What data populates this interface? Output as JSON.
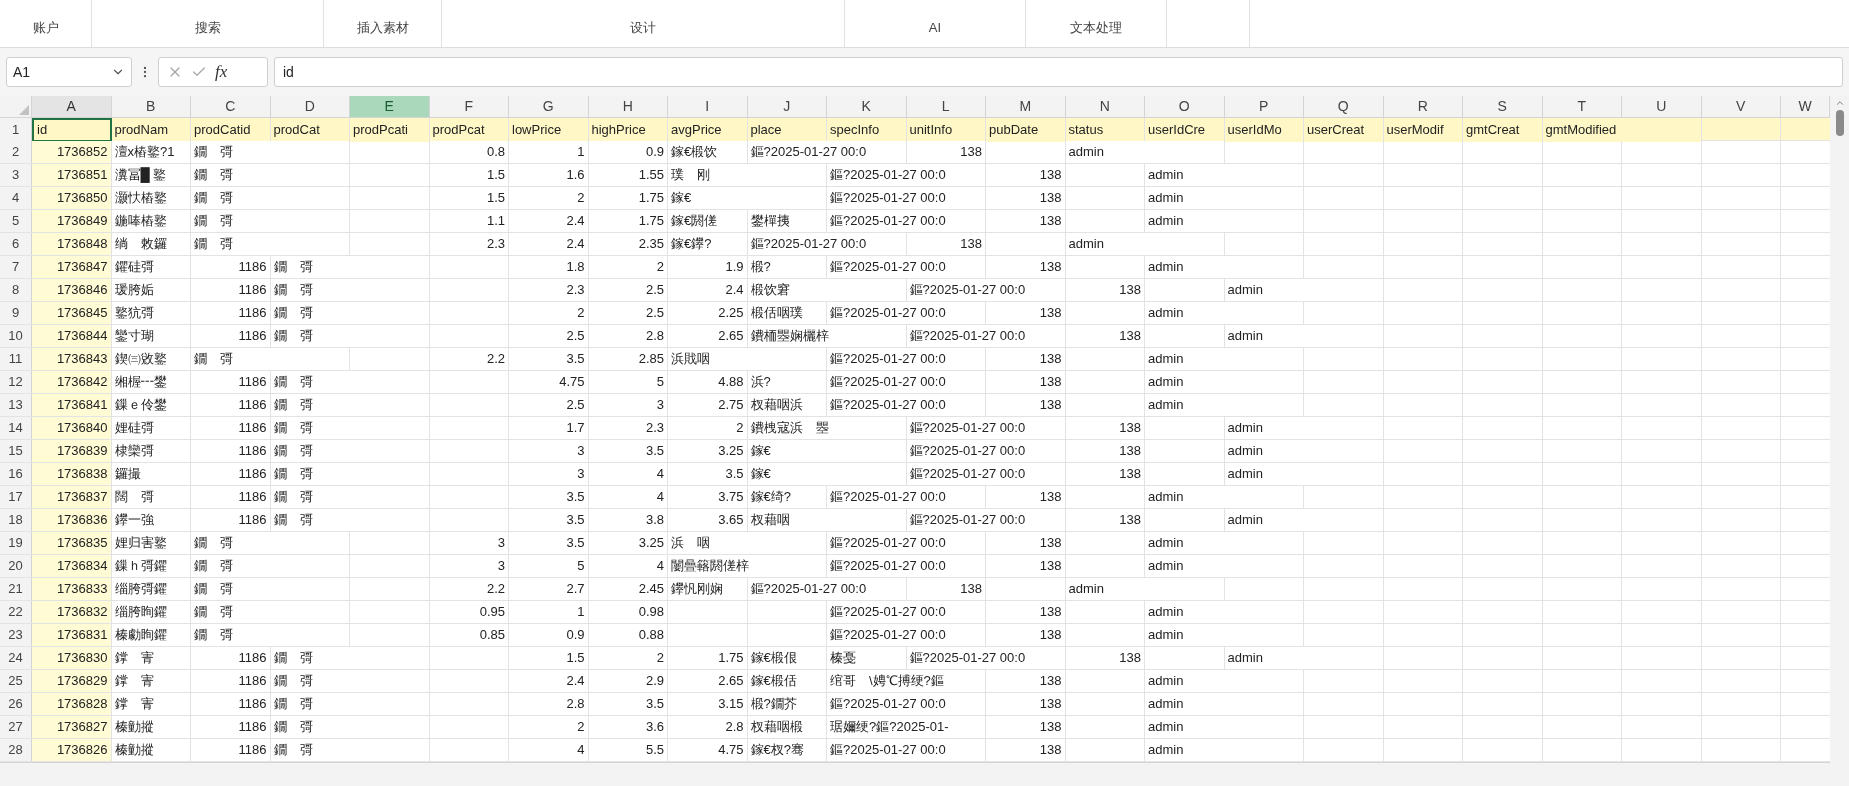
{
  "ribbon": {
    "groups": [
      {
        "label": "账户"
      },
      {
        "label": "搜索"
      },
      {
        "label": "插入素材"
      },
      {
        "label": "设计"
      },
      {
        "label": "AI"
      },
      {
        "label": "文本处理"
      }
    ]
  },
  "formula_bar": {
    "name_box": "A1",
    "fx": "fx",
    "value": "id"
  },
  "columns": [
    {
      "label": "A",
      "selected": false,
      "highlighted": true
    },
    {
      "label": "B",
      "selected": false,
      "highlighted": false
    },
    {
      "label": "C",
      "selected": false,
      "highlighted": false
    },
    {
      "label": "D",
      "selected": false,
      "highlighted": false
    },
    {
      "label": "E",
      "selected": true,
      "highlighted": false
    },
    {
      "label": "F",
      "selected": false,
      "highlighted": false
    },
    {
      "label": "G",
      "selected": false,
      "highlighted": false
    },
    {
      "label": "H",
      "selected": false,
      "highlighted": false
    },
    {
      "label": "I",
      "selected": false,
      "highlighted": false
    },
    {
      "label": "J",
      "selected": false,
      "highlighted": false
    },
    {
      "label": "K",
      "selected": false,
      "highlighted": false
    },
    {
      "label": "L",
      "selected": false,
      "highlighted": false
    },
    {
      "label": "M",
      "selected": false,
      "highlighted": false
    },
    {
      "label": "N",
      "selected": false,
      "highlighted": false
    },
    {
      "label": "O",
      "selected": false,
      "highlighted": false
    },
    {
      "label": "P",
      "selected": false,
      "highlighted": false
    },
    {
      "label": "Q",
      "selected": false,
      "highlighted": false
    },
    {
      "label": "R",
      "selected": false,
      "highlighted": false
    },
    {
      "label": "S",
      "selected": false,
      "highlighted": false
    },
    {
      "label": "T",
      "selected": false,
      "highlighted": false
    },
    {
      "label": "U",
      "selected": false,
      "highlighted": false
    },
    {
      "label": "V",
      "selected": false,
      "highlighted": false
    },
    {
      "label": "W",
      "selected": false,
      "highlighted": false
    }
  ],
  "header_row": {
    "num": "1",
    "cells": [
      {
        "text": "id",
        "selected": true
      },
      {
        "text": "prodNam",
        "selected": false
      },
      {
        "text": "prodCatid",
        "selected": false
      },
      {
        "text": "prodCat",
        "selected": false
      },
      {
        "text": "prodPcati",
        "selected": false
      },
      {
        "text": "prodPcat",
        "selected": false
      },
      {
        "text": "lowPrice",
        "selected": false
      },
      {
        "text": "highPrice",
        "selected": false
      },
      {
        "text": "avgPrice",
        "selected": false
      },
      {
        "text": "place",
        "selected": false
      },
      {
        "text": "specInfo",
        "selected": false
      },
      {
        "text": "unitInfo",
        "selected": false
      },
      {
        "text": "pubDate",
        "selected": false
      },
      {
        "text": "status",
        "selected": false
      },
      {
        "text": "userIdCre",
        "selected": false
      },
      {
        "text": "userIdMo",
        "selected": false
      },
      {
        "text": "userCreat",
        "selected": false
      },
      {
        "text": "userModif",
        "selected": false
      },
      {
        "text": "gmtCreat",
        "selected": false
      },
      {
        "text": "gmtModified",
        "selected": false
      }
    ]
  },
  "rows": [
    {
      "num": "2",
      "cells": [
        {
          "kind": "num",
          "text": "1736852"
        },
        {
          "kind": "text",
          "text": "澶x樁鐜?1"
        },
        {
          "kind": "text",
          "text": "鐗　彁"
        },
        {
          "kind": "empty"
        },
        {
          "kind": "empty"
        },
        {
          "kind": "num",
          "text": "0.8"
        },
        {
          "kind": "num",
          "text": "1"
        },
        {
          "kind": "num",
          "text": "0.9"
        },
        {
          "kind": "text",
          "text": "鎵€椴饮"
        },
        {
          "kind": "text",
          "text": "鏂?2025-01-27 00:0"
        },
        {
          "kind": "empty"
        },
        {
          "kind": "num",
          "text": "138"
        },
        {
          "kind": "empty"
        },
        {
          "kind": "text",
          "text": "admin"
        }
      ]
    },
    {
      "num": "3",
      "cells": [
        {
          "kind": "num",
          "text": "1736851"
        },
        {
          "kind": "text",
          "text": "瀵冨█ 鐜"
        },
        {
          "kind": "text",
          "text": "鐗　彁"
        },
        {
          "kind": "empty"
        },
        {
          "kind": "empty"
        },
        {
          "kind": "num",
          "text": "1.5"
        },
        {
          "kind": "num",
          "text": "1.6"
        },
        {
          "kind": "num",
          "text": "1.55"
        },
        {
          "kind": "text",
          "text": "璞　刚"
        },
        {
          "kind": "empty"
        },
        {
          "kind": "text",
          "text": "鏂?2025-01-27 00:0"
        },
        {
          "kind": "empty"
        },
        {
          "kind": "num",
          "text": "138"
        },
        {
          "kind": "empty"
        },
        {
          "kind": "text",
          "text": "admin"
        }
      ]
    },
    {
      "num": "4",
      "cells": [
        {
          "kind": "num",
          "text": "1736850"
        },
        {
          "kind": "text",
          "text": "灏忕樁鐜"
        },
        {
          "kind": "text",
          "text": "鐗　彁"
        },
        {
          "kind": "empty"
        },
        {
          "kind": "empty"
        },
        {
          "kind": "num",
          "text": "1.5"
        },
        {
          "kind": "num",
          "text": "2"
        },
        {
          "kind": "num",
          "text": "1.75"
        },
        {
          "kind": "text",
          "text": "鎵€"
        },
        {
          "kind": "empty"
        },
        {
          "kind": "text",
          "text": "鏂?2025-01-27 00:0"
        },
        {
          "kind": "empty"
        },
        {
          "kind": "num",
          "text": "138"
        },
        {
          "kind": "empty"
        },
        {
          "kind": "text",
          "text": "admin"
        }
      ]
    },
    {
      "num": "5",
      "cells": [
        {
          "kind": "num",
          "text": "1736849"
        },
        {
          "kind": "text",
          "text": "鍦唪樁鐜"
        },
        {
          "kind": "text",
          "text": "鐗　彁"
        },
        {
          "kind": "empty"
        },
        {
          "kind": "empty"
        },
        {
          "kind": "num",
          "text": "1.1"
        },
        {
          "kind": "num",
          "text": "2.4"
        },
        {
          "kind": "num",
          "text": "1.75"
        },
        {
          "kind": "text",
          "text": "鎵€閼傞"
        },
        {
          "kind": "text",
          "text": "鐢樿挗"
        },
        {
          "kind": "text",
          "text": "鏂?2025-01-27 00:0"
        },
        {
          "kind": "empty"
        },
        {
          "kind": "num",
          "text": "138"
        },
        {
          "kind": "empty"
        },
        {
          "kind": "text",
          "text": "admin"
        }
      ]
    },
    {
      "num": "6",
      "cells": [
        {
          "kind": "num",
          "text": "1736848"
        },
        {
          "kind": "text",
          "text": "绱　敇鑼"
        },
        {
          "kind": "text",
          "text": "鐗　彁"
        },
        {
          "kind": "empty"
        },
        {
          "kind": "empty"
        },
        {
          "kind": "num",
          "text": "2.3"
        },
        {
          "kind": "num",
          "text": "2.4"
        },
        {
          "kind": "num",
          "text": "2.35"
        },
        {
          "kind": "text",
          "text": "鎵€鑻?"
        },
        {
          "kind": "text",
          "text": "鏂?2025-01-27 00:0"
        },
        {
          "kind": "empty"
        },
        {
          "kind": "num",
          "text": "138"
        },
        {
          "kind": "empty"
        },
        {
          "kind": "text",
          "text": "admin"
        }
      ]
    },
    {
      "num": "7",
      "cells": [
        {
          "kind": "num",
          "text": "1736847"
        },
        {
          "kind": "text",
          "text": "鑺硅彁"
        },
        {
          "kind": "num",
          "text": "1186"
        },
        {
          "kind": "text",
          "text": "鐗　彁"
        },
        {
          "kind": "empty"
        },
        {
          "kind": "empty"
        },
        {
          "kind": "num",
          "text": "1.8"
        },
        {
          "kind": "num",
          "text": "2"
        },
        {
          "kind": "num",
          "text": "1.9"
        },
        {
          "kind": "text",
          "text": "椴?"
        },
        {
          "kind": "text",
          "text": "鏂?2025-01-27 00:0"
        },
        {
          "kind": "empty"
        },
        {
          "kind": "num",
          "text": "138"
        },
        {
          "kind": "empty"
        },
        {
          "kind": "text",
          "text": "admin"
        }
      ]
    },
    {
      "num": "8",
      "cells": [
        {
          "kind": "num",
          "text": "1736846"
        },
        {
          "kind": "text",
          "text": "瑗胯姤"
        },
        {
          "kind": "num",
          "text": "1186"
        },
        {
          "kind": "text",
          "text": "鐗　彁"
        },
        {
          "kind": "empty"
        },
        {
          "kind": "empty"
        },
        {
          "kind": "num",
          "text": "2.3"
        },
        {
          "kind": "num",
          "text": "2.5"
        },
        {
          "kind": "num",
          "text": "2.4"
        },
        {
          "kind": "text",
          "text": "椴饮窘"
        },
        {
          "kind": "empty"
        },
        {
          "kind": "text",
          "text": "鏂?2025-01-27 00:0"
        },
        {
          "kind": "empty"
        },
        {
          "kind": "num",
          "text": "138"
        },
        {
          "kind": "empty"
        },
        {
          "kind": "text",
          "text": "admin"
        }
      ]
    },
    {
      "num": "9",
      "cells": [
        {
          "kind": "num",
          "text": "1736845"
        },
        {
          "kind": "text",
          "text": "鐜犺彁"
        },
        {
          "kind": "num",
          "text": "1186"
        },
        {
          "kind": "text",
          "text": "鐗　彁"
        },
        {
          "kind": "empty"
        },
        {
          "kind": "empty"
        },
        {
          "kind": "num",
          "text": "2"
        },
        {
          "kind": "num",
          "text": "2.5"
        },
        {
          "kind": "num",
          "text": "2.25"
        },
        {
          "kind": "text",
          "text": "椴佸咽璞"
        },
        {
          "kind": "text",
          "text": "鏂?2025-01-27 00:0"
        },
        {
          "kind": "empty"
        },
        {
          "kind": "num",
          "text": "138"
        },
        {
          "kind": "empty"
        },
        {
          "kind": "text",
          "text": "admin"
        }
      ]
    },
    {
      "num": "10",
      "cells": [
        {
          "kind": "num",
          "text": "1736844"
        },
        {
          "kind": "text",
          "text": "鑾寸瑚"
        },
        {
          "kind": "num",
          "text": "1186"
        },
        {
          "kind": "text",
          "text": "鐗　彁"
        },
        {
          "kind": "empty"
        },
        {
          "kind": "empty"
        },
        {
          "kind": "num",
          "text": "2.5"
        },
        {
          "kind": "num",
          "text": "2.8"
        },
        {
          "kind": "num",
          "text": "2.65"
        },
        {
          "kind": "text",
          "text": "鐨栭瞾娴欐梓"
        },
        {
          "kind": "empty"
        },
        {
          "kind": "text",
          "text": "鏂?2025-01-27 00:0"
        },
        {
          "kind": "empty"
        },
        {
          "kind": "num",
          "text": "138"
        },
        {
          "kind": "empty"
        },
        {
          "kind": "text",
          "text": "admin"
        }
      ]
    },
    {
      "num": "11",
      "cells": [
        {
          "kind": "num",
          "text": "1736843"
        },
        {
          "kind": "text",
          "text": "鍥㈢敓鐜"
        },
        {
          "kind": "text",
          "text": "鐗　彁"
        },
        {
          "kind": "empty"
        },
        {
          "kind": "empty"
        },
        {
          "kind": "num",
          "text": "2.2"
        },
        {
          "kind": "num",
          "text": "3.5"
        },
        {
          "kind": "num",
          "text": "2.85"
        },
        {
          "kind": "text",
          "text": "浜戝咽"
        },
        {
          "kind": "empty"
        },
        {
          "kind": "text",
          "text": "鏂?2025-01-27 00:0"
        },
        {
          "kind": "empty"
        },
        {
          "kind": "num",
          "text": "138"
        },
        {
          "kind": "empty"
        },
        {
          "kind": "text",
          "text": "admin"
        }
      ]
    },
    {
      "num": "12",
      "cells": [
        {
          "kind": "num",
          "text": "1736842"
        },
        {
          "kind": "text",
          "text": "缃楃┅鐢"
        },
        {
          "kind": "num",
          "text": "1186"
        },
        {
          "kind": "text",
          "text": "鐗　彁"
        },
        {
          "kind": "empty"
        },
        {
          "kind": "empty"
        },
        {
          "kind": "num",
          "text": "4.75"
        },
        {
          "kind": "num",
          "text": "5"
        },
        {
          "kind": "num",
          "text": "4.88"
        },
        {
          "kind": "text",
          "text": "浜?"
        },
        {
          "kind": "text",
          "text": "鏂?2025-01-27 00:0"
        },
        {
          "kind": "empty"
        },
        {
          "kind": "num",
          "text": "138"
        },
        {
          "kind": "empty"
        },
        {
          "kind": "text",
          "text": "admin"
        }
      ]
    },
    {
      "num": "13",
      "cells": [
        {
          "kind": "num",
          "text": "1736841"
        },
        {
          "kind": "text",
          "text": "鏁ｅ伶鐢"
        },
        {
          "kind": "num",
          "text": "1186"
        },
        {
          "kind": "text",
          "text": "鐗　彁"
        },
        {
          "kind": "empty"
        },
        {
          "kind": "empty"
        },
        {
          "kind": "num",
          "text": "2.5"
        },
        {
          "kind": "num",
          "text": "3"
        },
        {
          "kind": "num",
          "text": "2.75"
        },
        {
          "kind": "text",
          "text": "杈藉咽浜"
        },
        {
          "kind": "text",
          "text": "鏂?2025-01-27 00:0"
        },
        {
          "kind": "empty"
        },
        {
          "kind": "num",
          "text": "138"
        },
        {
          "kind": "empty"
        },
        {
          "kind": "text",
          "text": "admin"
        }
      ]
    },
    {
      "num": "14",
      "cells": [
        {
          "kind": "num",
          "text": "1736840"
        },
        {
          "kind": "text",
          "text": "娌硅彁"
        },
        {
          "kind": "num",
          "text": "1186"
        },
        {
          "kind": "text",
          "text": "鐗　彁"
        },
        {
          "kind": "empty"
        },
        {
          "kind": "empty"
        },
        {
          "kind": "num",
          "text": "1.7"
        },
        {
          "kind": "num",
          "text": "2.3"
        },
        {
          "kind": "num",
          "text": "2"
        },
        {
          "kind": "text",
          "text": "鐨栧寇浜　瞾"
        },
        {
          "kind": "empty"
        },
        {
          "kind": "text",
          "text": "鏂?2025-01-27 00:0"
        },
        {
          "kind": "empty"
        },
        {
          "kind": "num",
          "text": "138"
        },
        {
          "kind": "empty"
        },
        {
          "kind": "text",
          "text": "admin"
        }
      ]
    },
    {
      "num": "15",
      "cells": [
        {
          "kind": "num",
          "text": "1736839"
        },
        {
          "kind": "text",
          "text": "棣欒彁"
        },
        {
          "kind": "num",
          "text": "1186"
        },
        {
          "kind": "text",
          "text": "鐗　彁"
        },
        {
          "kind": "empty"
        },
        {
          "kind": "empty"
        },
        {
          "kind": "num",
          "text": "3"
        },
        {
          "kind": "num",
          "text": "3.5"
        },
        {
          "kind": "num",
          "text": "3.25"
        },
        {
          "kind": "text",
          "text": "鎵€"
        },
        {
          "kind": "empty"
        },
        {
          "kind": "text",
          "text": "鏂?2025-01-27 00:0"
        },
        {
          "kind": "empty"
        },
        {
          "kind": "num",
          "text": "138"
        },
        {
          "kind": "empty"
        },
        {
          "kind": "text",
          "text": "admin"
        }
      ]
    },
    {
      "num": "16",
      "cells": [
        {
          "kind": "num",
          "text": "1736838"
        },
        {
          "kind": "text",
          "text": "鑼撮"
        },
        {
          "kind": "num",
          "text": "1186"
        },
        {
          "kind": "text",
          "text": "鐗　彁"
        },
        {
          "kind": "empty"
        },
        {
          "kind": "empty"
        },
        {
          "kind": "num",
          "text": "3"
        },
        {
          "kind": "num",
          "text": "4"
        },
        {
          "kind": "num",
          "text": "3.5"
        },
        {
          "kind": "text",
          "text": "鎵€"
        },
        {
          "kind": "empty"
        },
        {
          "kind": "text",
          "text": "鏂?2025-01-27 00:0"
        },
        {
          "kind": "empty"
        },
        {
          "kind": "num",
          "text": "138"
        },
        {
          "kind": "empty"
        },
        {
          "kind": "text",
          "text": "admin"
        }
      ]
    },
    {
      "num": "17",
      "cells": [
        {
          "kind": "num",
          "text": "1736837"
        },
        {
          "kind": "text",
          "text": "闊　彁"
        },
        {
          "kind": "num",
          "text": "1186"
        },
        {
          "kind": "text",
          "text": "鐗　彁"
        },
        {
          "kind": "empty"
        },
        {
          "kind": "empty"
        },
        {
          "kind": "num",
          "text": "3.5"
        },
        {
          "kind": "num",
          "text": "4"
        },
        {
          "kind": "num",
          "text": "3.75"
        },
        {
          "kind": "text",
          "text": "鎵€绮?"
        },
        {
          "kind": "text",
          "text": "鏂?2025-01-27 00:0"
        },
        {
          "kind": "empty"
        },
        {
          "kind": "num",
          "text": "138"
        },
        {
          "kind": "empty"
        },
        {
          "kind": "text",
          "text": "admin"
        }
      ]
    },
    {
      "num": "18",
      "cells": [
        {
          "kind": "num",
          "text": "1736836"
        },
        {
          "kind": "text",
          "text": "鑻一強"
        },
        {
          "kind": "num",
          "text": "1186"
        },
        {
          "kind": "text",
          "text": "鐗　彁"
        },
        {
          "kind": "empty"
        },
        {
          "kind": "empty"
        },
        {
          "kind": "num",
          "text": "3.5"
        },
        {
          "kind": "num",
          "text": "3.8"
        },
        {
          "kind": "num",
          "text": "3.65"
        },
        {
          "kind": "text",
          "text": "杈藉咽"
        },
        {
          "kind": "empty"
        },
        {
          "kind": "text",
          "text": "鏂?2025-01-27 00:0"
        },
        {
          "kind": "empty"
        },
        {
          "kind": "num",
          "text": "138"
        },
        {
          "kind": "empty"
        },
        {
          "kind": "text",
          "text": "admin"
        }
      ]
    },
    {
      "num": "19",
      "cells": [
        {
          "kind": "num",
          "text": "1736835"
        },
        {
          "kind": "text",
          "text": "娌归害鐜"
        },
        {
          "kind": "text",
          "text": "鐗　彁"
        },
        {
          "kind": "empty"
        },
        {
          "kind": "empty"
        },
        {
          "kind": "num",
          "text": "3"
        },
        {
          "kind": "num",
          "text": "3.5"
        },
        {
          "kind": "num",
          "text": "3.25"
        },
        {
          "kind": "text",
          "text": "浜　咽"
        },
        {
          "kind": "empty"
        },
        {
          "kind": "text",
          "text": "鏂?2025-01-27 00:0"
        },
        {
          "kind": "empty"
        },
        {
          "kind": "num",
          "text": "138"
        },
        {
          "kind": "empty"
        },
        {
          "kind": "text",
          "text": "admin"
        }
      ]
    },
    {
      "num": "20",
      "cells": [
        {
          "kind": "num",
          "text": "1736834"
        },
        {
          "kind": "text",
          "text": "鏁ｈ彁鑺"
        },
        {
          "kind": "text",
          "text": "鐗　彁"
        },
        {
          "kind": "empty"
        },
        {
          "kind": "empty"
        },
        {
          "kind": "num",
          "text": "3"
        },
        {
          "kind": "num",
          "text": "5"
        },
        {
          "kind": "num",
          "text": "4"
        },
        {
          "kind": "text",
          "text": "闄曡簵閼傞梓"
        },
        {
          "kind": "empty"
        },
        {
          "kind": "text",
          "text": "鏂?2025-01-27 00:0"
        },
        {
          "kind": "empty"
        },
        {
          "kind": "num",
          "text": "138"
        },
        {
          "kind": "empty"
        },
        {
          "kind": "text",
          "text": "admin"
        }
      ]
    },
    {
      "num": "21",
      "cells": [
        {
          "kind": "num",
          "text": "1736833"
        },
        {
          "kind": "text",
          "text": "缁胯彁鑺"
        },
        {
          "kind": "text",
          "text": "鐗　彁"
        },
        {
          "kind": "empty"
        },
        {
          "kind": "empty"
        },
        {
          "kind": "num",
          "text": "2.2"
        },
        {
          "kind": "num",
          "text": "2.7"
        },
        {
          "kind": "num",
          "text": "2.45"
        },
        {
          "kind": "text",
          "text": "鑻忛刚娴"
        },
        {
          "kind": "text",
          "text": "鏂?2025-01-27 00:0"
        },
        {
          "kind": "empty"
        },
        {
          "kind": "num",
          "text": "138"
        },
        {
          "kind": "empty"
        },
        {
          "kind": "text",
          "text": "admin"
        }
      ]
    },
    {
      "num": "22",
      "cells": [
        {
          "kind": "num",
          "text": "1736832"
        },
        {
          "kind": "text",
          "text": "缁胯眴鑺"
        },
        {
          "kind": "text",
          "text": "鐗　彁"
        },
        {
          "kind": "empty"
        },
        {
          "kind": "empty"
        },
        {
          "kind": "num",
          "text": "0.95"
        },
        {
          "kind": "num",
          "text": "1"
        },
        {
          "kind": "num",
          "text": "0.98"
        },
        {
          "kind": "empty"
        },
        {
          "kind": "empty"
        },
        {
          "kind": "text",
          "text": "鏂?2025-01-27 00:0"
        },
        {
          "kind": "empty"
        },
        {
          "kind": "num",
          "text": "138"
        },
        {
          "kind": "empty"
        },
        {
          "kind": "text",
          "text": "admin"
        }
      ]
    },
    {
      "num": "23",
      "cells": [
        {
          "kind": "num",
          "text": "1736831"
        },
        {
          "kind": "text",
          "text": "榛勮眴鑺"
        },
        {
          "kind": "text",
          "text": "鐗　彁"
        },
        {
          "kind": "empty"
        },
        {
          "kind": "empty"
        },
        {
          "kind": "num",
          "text": "0.85"
        },
        {
          "kind": "num",
          "text": "0.9"
        },
        {
          "kind": "num",
          "text": "0.88"
        },
        {
          "kind": "empty"
        },
        {
          "kind": "empty"
        },
        {
          "kind": "text",
          "text": "鏂?2025-01-27 00:0"
        },
        {
          "kind": "empty"
        },
        {
          "kind": "num",
          "text": "138"
        },
        {
          "kind": "empty"
        },
        {
          "kind": "text",
          "text": "admin"
        }
      ]
    },
    {
      "num": "24",
      "cells": [
        {
          "kind": "num",
          "text": "1736830"
        },
        {
          "kind": "text",
          "text": "鐣　寈"
        },
        {
          "kind": "num",
          "text": "1186"
        },
        {
          "kind": "text",
          "text": "鐗　彁"
        },
        {
          "kind": "empty"
        },
        {
          "kind": "empty"
        },
        {
          "kind": "num",
          "text": "1.5"
        },
        {
          "kind": "num",
          "text": "2"
        },
        {
          "kind": "num",
          "text": "1.75"
        },
        {
          "kind": "text",
          "text": "鎵€椴佷"
        },
        {
          "kind": "text",
          "text": "榛戞"
        },
        {
          "kind": "text",
          "text": "鏂?2025-01-27 00:0"
        },
        {
          "kind": "empty"
        },
        {
          "kind": "num",
          "text": "138"
        },
        {
          "kind": "empty"
        },
        {
          "kind": "text",
          "text": "admin"
        }
      ]
    },
    {
      "num": "25",
      "cells": [
        {
          "kind": "num",
          "text": "1736829"
        },
        {
          "kind": "text",
          "text": "鐣　寈"
        },
        {
          "kind": "num",
          "text": "1186"
        },
        {
          "kind": "text",
          "text": "鐗　彁"
        },
        {
          "kind": "empty"
        },
        {
          "kind": "empty"
        },
        {
          "kind": "num",
          "text": "2.4"
        },
        {
          "kind": "num",
          "text": "2.9"
        },
        {
          "kind": "num",
          "text": "2.65"
        },
        {
          "kind": "text",
          "text": "鎵€椴佸"
        },
        {
          "kind": "text",
          "text": "绾哥　\\娉℃搏绠?鏂"
        },
        {
          "kind": "empty"
        },
        {
          "kind": "num",
          "text": "138"
        },
        {
          "kind": "empty"
        },
        {
          "kind": "text",
          "text": "admin"
        }
      ]
    },
    {
      "num": "26",
      "cells": [
        {
          "kind": "num",
          "text": "1736828"
        },
        {
          "kind": "text",
          "text": "鐣　寈"
        },
        {
          "kind": "num",
          "text": "1186"
        },
        {
          "kind": "text",
          "text": "鐗　彁"
        },
        {
          "kind": "empty"
        },
        {
          "kind": "empty"
        },
        {
          "kind": "num",
          "text": "2.8"
        },
        {
          "kind": "num",
          "text": "3.5"
        },
        {
          "kind": "num",
          "text": "3.15"
        },
        {
          "kind": "text",
          "text": "椴?鐗芥"
        },
        {
          "kind": "text",
          "text": "鏂?2025-01-27 00:0"
        },
        {
          "kind": "empty"
        },
        {
          "kind": "num",
          "text": "138"
        },
        {
          "kind": "empty"
        },
        {
          "kind": "text",
          "text": "admin"
        }
      ]
    },
    {
      "num": "27",
      "cells": [
        {
          "kind": "num",
          "text": "1736827"
        },
        {
          "kind": "text",
          "text": "榛勭摐"
        },
        {
          "kind": "num",
          "text": "1186"
        },
        {
          "kind": "text",
          "text": "鐗　彁"
        },
        {
          "kind": "empty"
        },
        {
          "kind": "empty"
        },
        {
          "kind": "num",
          "text": "2"
        },
        {
          "kind": "num",
          "text": "3.6"
        },
        {
          "kind": "num",
          "text": "2.8"
        },
        {
          "kind": "text",
          "text": "杈藉咽椴"
        },
        {
          "kind": "text",
          "text": "琚嬭绠?鏂?2025-01-"
        },
        {
          "kind": "empty"
        },
        {
          "kind": "num",
          "text": "138"
        },
        {
          "kind": "empty"
        },
        {
          "kind": "text",
          "text": "admin"
        }
      ]
    },
    {
      "num": "28",
      "cells": [
        {
          "kind": "num",
          "text": "1736826"
        },
        {
          "kind": "text",
          "text": "榛勭摐"
        },
        {
          "kind": "num",
          "text": "1186"
        },
        {
          "kind": "text",
          "text": "鐗　彁"
        },
        {
          "kind": "empty"
        },
        {
          "kind": "empty"
        },
        {
          "kind": "num",
          "text": "4"
        },
        {
          "kind": "num",
          "text": "5.5"
        },
        {
          "kind": "num",
          "text": "4.75"
        },
        {
          "kind": "text",
          "text": "鎵€杈?骞"
        },
        {
          "kind": "text",
          "text": "鏂?2025-01-27 00:0"
        },
        {
          "kind": "empty"
        },
        {
          "kind": "num",
          "text": "138"
        },
        {
          "kind": "empty"
        },
        {
          "kind": "text",
          "text": "admin"
        }
      ]
    }
  ]
}
